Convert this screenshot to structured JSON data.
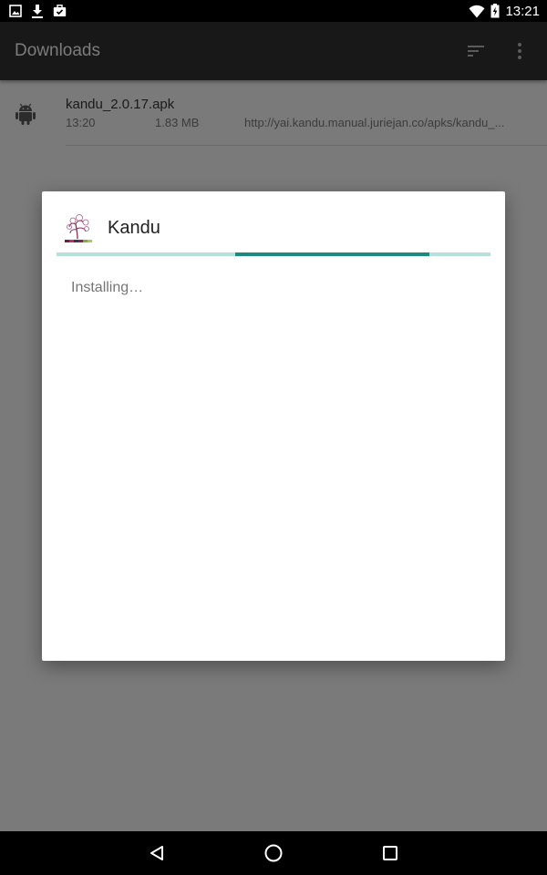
{
  "status_bar": {
    "time": "13:21",
    "left_icons": [
      "image-icon",
      "download-icon",
      "briefcase-check-icon"
    ],
    "right_icons": [
      "wifi-icon",
      "battery-icon"
    ]
  },
  "toolbar": {
    "title": "Downloads",
    "sort_icon": "sort-icon",
    "more_icon": "more-vert-icon"
  },
  "download": {
    "file_name": "kandu_2.0.17.apk",
    "time": "13:20",
    "size": "1.83 MB",
    "url": "http://yai.kandu.manual.juriejan.co/apks/kandu_...",
    "icon": "android-icon"
  },
  "dialog": {
    "app_name": "Kandu",
    "message": "Installing…",
    "progress_state": "indeterminate",
    "app_icon": "kandu-logo-icon"
  },
  "colors": {
    "accent": "#1a8c7f",
    "progress_track": "#b7e0dc",
    "toolbar": "#181818",
    "scrim_background": "#7a7a7a"
  },
  "nav_bar": {
    "icons": [
      "back-icon",
      "home-icon",
      "recents-icon"
    ]
  }
}
